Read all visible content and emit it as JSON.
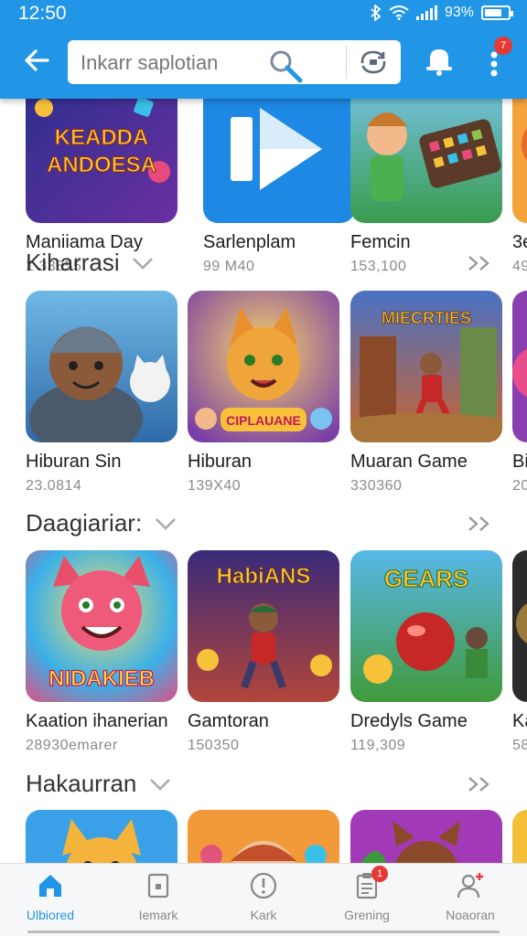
{
  "status": {
    "time": "12:50",
    "battery": "93%"
  },
  "search": {
    "placeholder": "Inkarr saplotian"
  },
  "notifications": {
    "badge": "7"
  },
  "top_row": [
    {
      "name": "Maniiama Day",
      "meta": "1 33855",
      "art_text": "KEADDA ANDOESA",
      "bg1": "#2b2f8f",
      "bg2": "#6a2fa0"
    },
    {
      "name": "Sarlenplam",
      "meta": "99 M40",
      "bg1": "#1e88e5",
      "bg2": "#1565c0"
    },
    {
      "name": "Femcin",
      "meta": "153,100",
      "bg1": "#7bc6f0",
      "bg2": "#3a9b4e"
    },
    {
      "name": "3e",
      "meta": "49",
      "bg1": "#f4a23a",
      "bg2": "#e86b2a"
    }
  ],
  "sections": [
    {
      "title": "Kiharrasi",
      "apps": [
        {
          "name": "Hiburan Sin",
          "meta": "23.0814",
          "bg1": "#6fb8e6",
          "bg2": "#2f6aa8"
        },
        {
          "name": "Hiburan",
          "meta": "139X40",
          "art_text": "CIPLAUANE",
          "bg1": "#f0a53b",
          "bg2": "#7a3fa6"
        },
        {
          "name": "Muaran Game",
          "meta": "330360",
          "art_text": "MIECRTIES",
          "bg1": "#4a72c4",
          "bg2": "#c9642e"
        },
        {
          "name": "Bi",
          "meta": "20",
          "bg1": "#8a3fb0",
          "bg2": "#e94c8a"
        }
      ]
    },
    {
      "title": "Daagiariar:",
      "apps": [
        {
          "name": "Kaation ihanerian",
          "meta": "28930emarer",
          "art_text": "NIDAKIEB",
          "bg1": "#f7c23a",
          "bg2": "#e84a7b"
        },
        {
          "name": "Gamtoran",
          "meta": "150350",
          "art_text": "HabiANS",
          "bg1": "#3a2a7a",
          "bg2": "#b2453a"
        },
        {
          "name": "Dredyls Game",
          "meta": "119,309",
          "art_text": "GEARS",
          "bg1": "#58b8e8",
          "bg2": "#3f9a3a"
        },
        {
          "name": "Ka",
          "meta": "58",
          "bg1": "#2c2c2c",
          "bg2": "#9a7a3a"
        }
      ]
    },
    {
      "title": "Hakaurran",
      "apps": [
        {
          "name": "",
          "meta": "",
          "bg1": "#3aa0e8",
          "bg2": "#f4b33a"
        },
        {
          "name": "",
          "meta": "",
          "bg1": "#f29a3a",
          "bg2": "#e3547a"
        },
        {
          "name": "",
          "meta": "",
          "bg1": "#a23ab8",
          "bg2": "#5b2a8a"
        },
        {
          "name": "",
          "meta": "",
          "bg1": "#f4c03a",
          "bg2": "#e06a2a"
        }
      ]
    }
  ],
  "bottom_nav": [
    {
      "label": "Ulbiored",
      "icon": "home-icon",
      "active": true
    },
    {
      "label": "Iemark",
      "icon": "card-icon",
      "active": false
    },
    {
      "label": "Kark",
      "icon": "alert-circle-icon",
      "active": false
    },
    {
      "label": "Grening",
      "icon": "clipboard-icon",
      "active": false,
      "badge": "1"
    },
    {
      "label": "Noaoran",
      "icon": "add-user-icon",
      "active": false
    }
  ],
  "colors": {
    "primary": "#2196e6",
    "badge": "#e53935"
  }
}
